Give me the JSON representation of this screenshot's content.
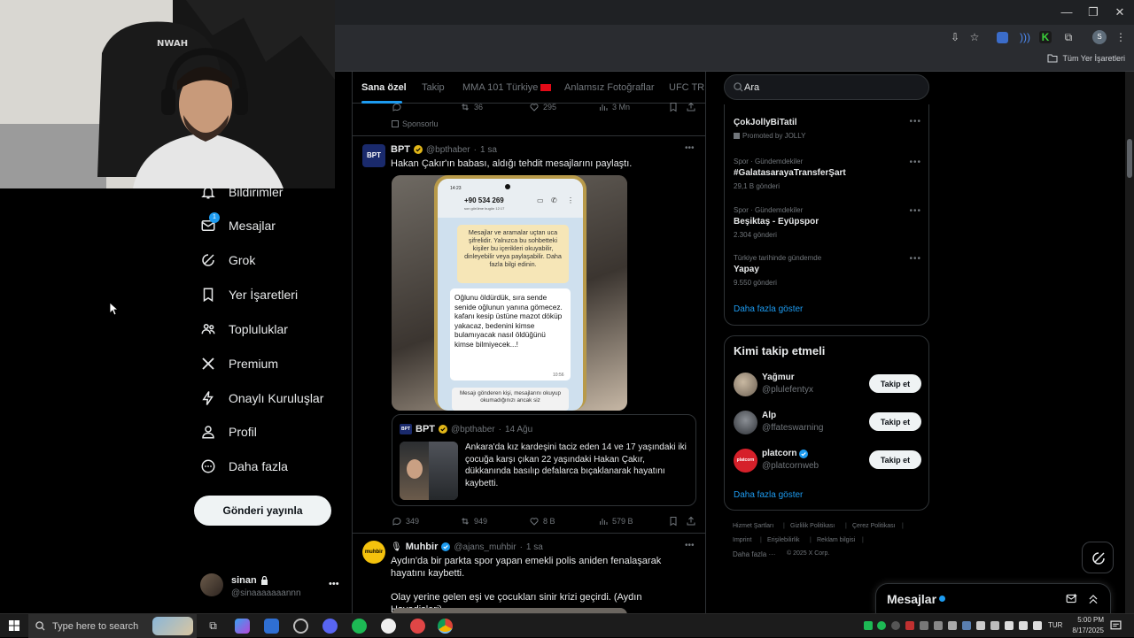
{
  "browser": {
    "bookmarks_label": "Tüm Yer İşaretleri",
    "profile_initial": "S"
  },
  "nav": {
    "items": [
      {
        "label": "Bildirimler",
        "icon": "bell-icon"
      },
      {
        "label": "Mesajlar",
        "icon": "envelope-icon",
        "badge": "1"
      },
      {
        "label": "Grok",
        "icon": "grok-icon"
      },
      {
        "label": "Yer İşaretleri",
        "icon": "bookmark-icon"
      },
      {
        "label": "Topluluklar",
        "icon": "people-icon"
      },
      {
        "label": "Premium",
        "icon": "x-logo-icon"
      },
      {
        "label": "Onaylı Kuruluşlar",
        "icon": "lightning-icon"
      },
      {
        "label": "Profil",
        "icon": "person-icon"
      },
      {
        "label": "Daha fazla",
        "icon": "more-circle-icon"
      }
    ],
    "post_button": "Gönderi yayınla"
  },
  "account": {
    "name": "sinan",
    "handle": "@sinaaaaaaannn"
  },
  "tabs": [
    "Sana özel",
    "Takip",
    "MMA 101 Türkiye",
    "Anlamsız Fotoğraflar",
    "UFC TR"
  ],
  "feed": {
    "top_actions": {
      "retweets": "36",
      "likes": "295",
      "views": "3 Mn"
    },
    "sponsored_label": "Sponsorlu",
    "tweet1": {
      "avatar_text": "BPT",
      "name": "BPT",
      "handle": "@bpthaber",
      "time": "1 sa",
      "text": "Hakan Çakır'ın babası, aldığı tehdit mesajlarını paylaştı.",
      "phone": {
        "time": "14:23",
        "contact": "+90 534 269",
        "contact_sub": "son görülme bugün 12:17",
        "enc_notice": "Mesajlar ve aramalar uçtan uca şifrelidir. Yalnızca bu sohbetteki kişiler bu içerikleri okuyabilir, dinleyebilir veya paylaşabilir. Daha fazla bilgi edinin.",
        "message": "Oğlunu öldürdük, sıra sende senide oğlunun yanına gömecez. kafanı kesip üstüne mazot döküp yakacaz, bedenini kimse bulamıyacak nasıl öldüğünü kimse bilmiyecek...!",
        "message_time": "10:56",
        "bottom_notice": "Mesajı gönderen kişi, mesajlarını okuyup okumadığınızı ancak siz"
      },
      "quote": {
        "avatar_text": "BPT",
        "name": "BPT",
        "handle": "@bpthaber",
        "time": "14 Ağu",
        "text": "Ankara'da kız kardeşini taciz eden 14 ve 17 yaşındaki iki çocuğa karşı çıkan 22 yaşındaki Hakan Çakır, dükkanında basılıp defalarca bıçaklanarak hayatını kaybetti."
      },
      "actions": {
        "replies": "349",
        "retweets": "949",
        "likes": "8 B",
        "views": "579 B"
      }
    },
    "tweet2": {
      "avatar_text": "muhbir",
      "name": "Muhbir",
      "handle": "@ajans_muhbir",
      "time": "1 sa",
      "text": "Aydın'da bir parkta spor yapan emekli polis aniden fenalaşarak hayatını kaybetti.",
      "text2": "Olay yerine gelen eşi ve çocukları sinir krizi geçirdi. (Aydın Havadisleri)"
    }
  },
  "search": {
    "placeholder": "Ara"
  },
  "trends": [
    {
      "category": "",
      "title": "ÇokJollyBiTatil",
      "count": "Promoted by JOLLY"
    },
    {
      "category": "Spor · Gündemdekiler",
      "title": "#GalatasarayaTransferŞart",
      "count": "29,1 B gönderi"
    },
    {
      "category": "Spor · Gündemdekiler",
      "title": "Beşiktaş - Eyüpspor",
      "count": "2.304 gönderi"
    },
    {
      "category": "Türkiye tarihinde gündemde",
      "title": "Yapay",
      "count": "9.550 gönderi"
    }
  ],
  "trends_more": "Daha fazla göster",
  "who_to_follow": {
    "title": "Kimi takip etmeli",
    "users": [
      {
        "name": "Yağmur",
        "handle": "@plulefentyx",
        "button": "Takip et",
        "color": "#8a7d6a"
      },
      {
        "name": "Alp",
        "handle": "@ffateswarning",
        "button": "Takip et",
        "color": "#4b4f55"
      },
      {
        "name": "platcorn",
        "handle": "@platcornweb",
        "button": "Takip et",
        "color": "#d6202a",
        "avatar_text": "platcorn"
      }
    ],
    "more": "Daha fazla göster"
  },
  "footer": {
    "links": [
      "Hizmet Şartları",
      "Gizlilik Politikası",
      "Çerez Politikası",
      "Imprint",
      "Erişilebilirlik",
      "Reklam bilgisi",
      "Daha fazla ···"
    ],
    "copyright": "© 2025 X Corp."
  },
  "messages_dock": {
    "title": "Mesajlar"
  },
  "taskbar": {
    "search_placeholder": "Type here to search",
    "lang": "TUR",
    "time": "5:00 PM",
    "date": "8/17/2025"
  },
  "colors": {
    "accent": "#1d9bf0",
    "gold": "#e2b719"
  }
}
